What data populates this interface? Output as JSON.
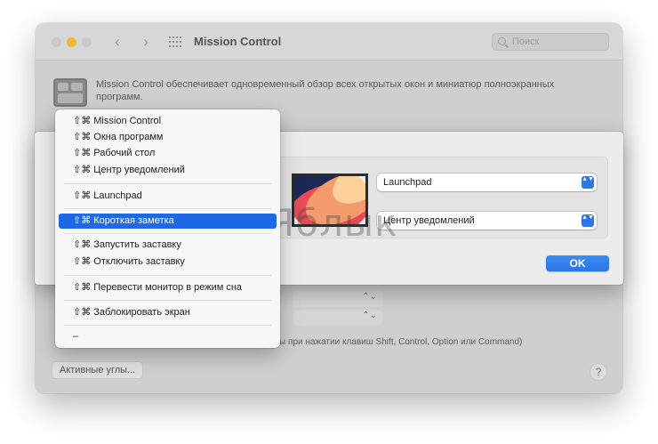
{
  "window": {
    "title": "Mission Control",
    "search_placeholder": "Поиск",
    "description": "Mission Control обеспечивает одновременный обзор всех открытых окон и миниатюр полноэкранных программ.",
    "hint_text": "ы при нажатии клавиш Shift, Control, Option или Command)",
    "active_corners_button": "Активные углы...",
    "help_label": "?",
    "back_glyph": "‹",
    "forward_glyph": "›"
  },
  "sheet": {
    "top_right_value": "Launchpad",
    "bottom_right_value": "Центр уведомлений",
    "ok_label": "OK",
    "stepper_glyph": "▲▼"
  },
  "menu": {
    "items": [
      {
        "label": "⇧⌘ Mission Control"
      },
      {
        "label": "⇧⌘ Окна программ"
      },
      {
        "label": "⇧⌘ Рабочий стол"
      },
      {
        "label": "⇧⌘ Центр уведомлений"
      },
      {
        "label": "⇧⌘ Launchpad"
      },
      {
        "label": "⇧⌘ Короткая заметка",
        "selected": true
      },
      {
        "label": "⇧⌘ Запустить заставку"
      },
      {
        "label": "⇧⌘ Отключить заставку"
      },
      {
        "label": "⇧⌘ Перевести монитор в режим сна"
      },
      {
        "label": "⇧⌘ Заблокировать экран"
      },
      {
        "label": "–"
      }
    ]
  },
  "watermark": "Яблык",
  "colors": {
    "accent": "#1e6ae6",
    "traffic_yellow": "#f1b734"
  }
}
